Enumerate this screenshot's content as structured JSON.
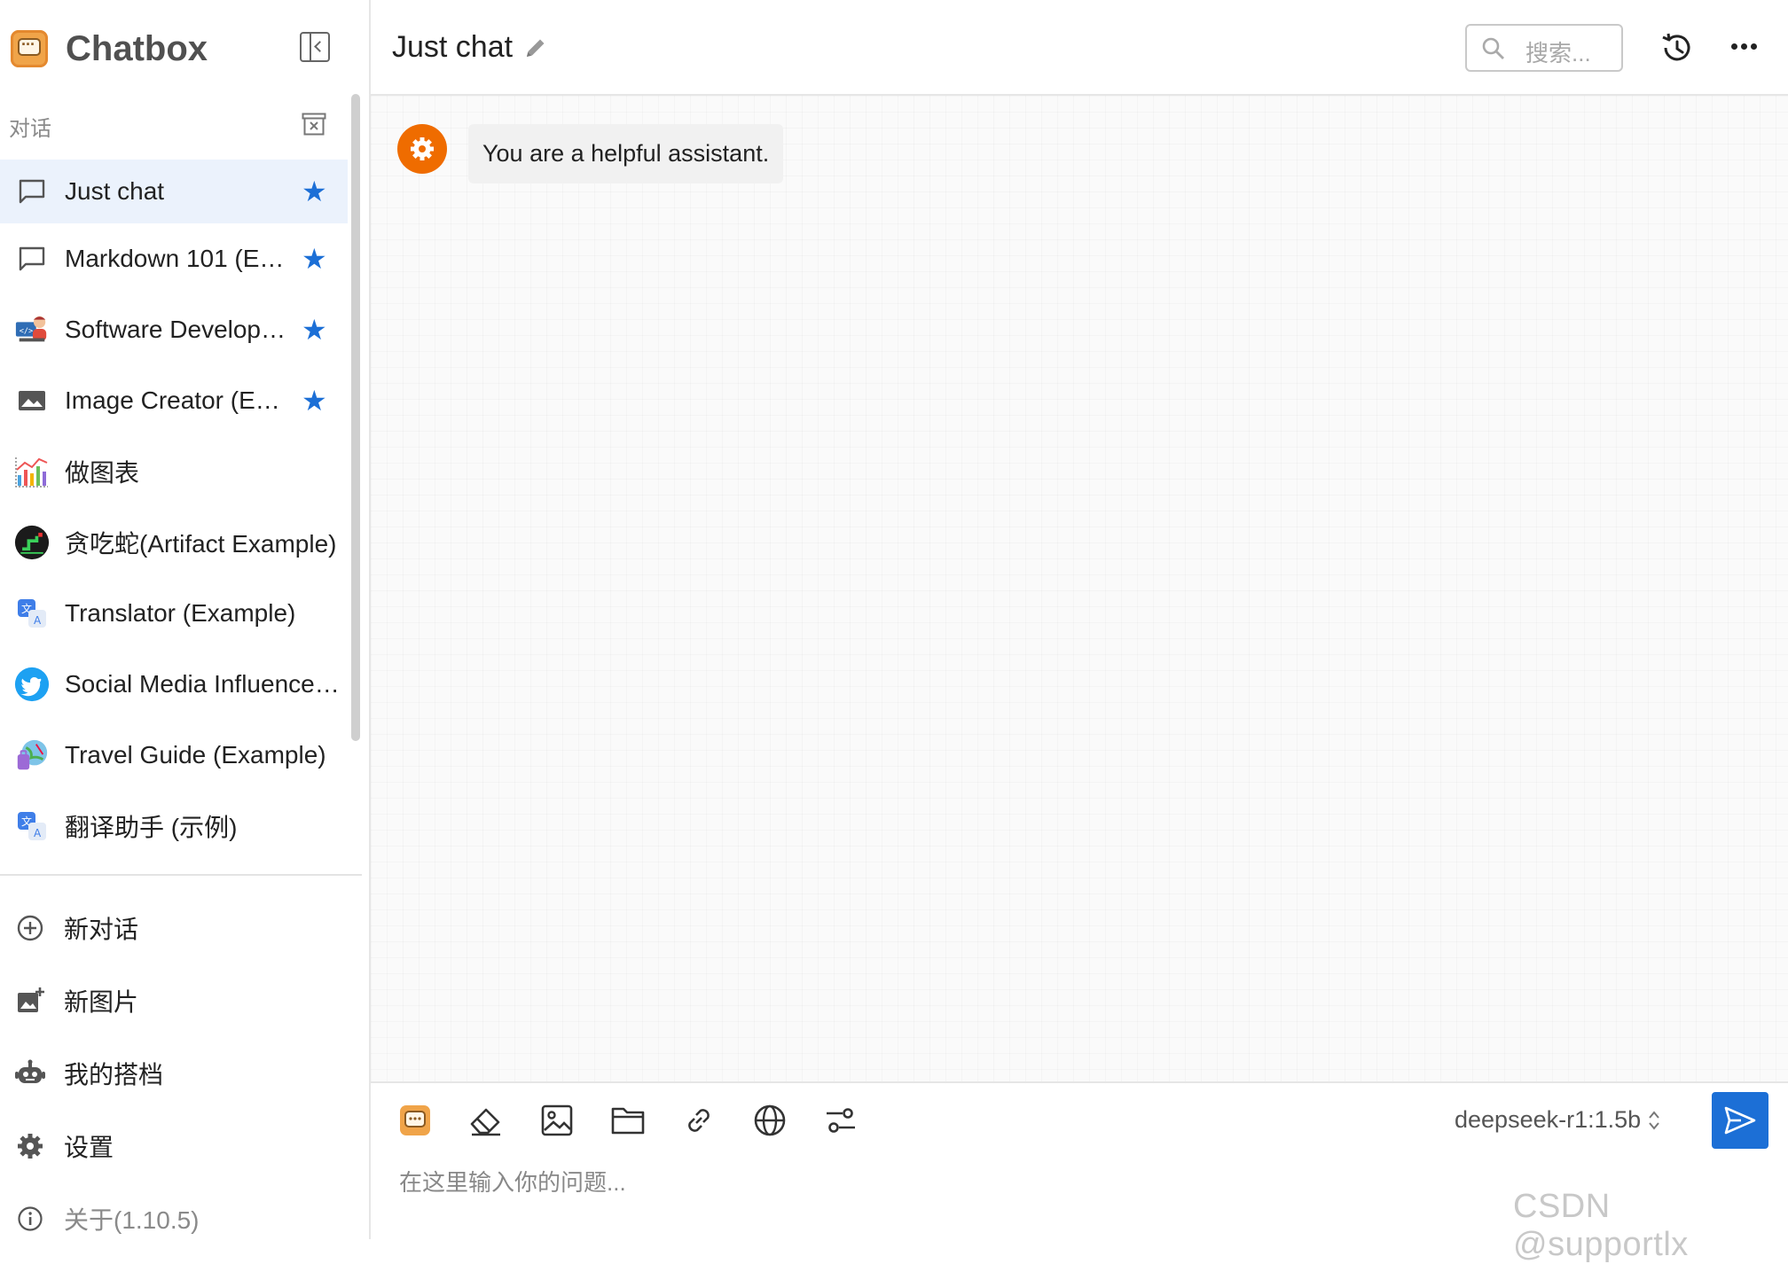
{
  "app": {
    "name": "Chatbox"
  },
  "sidebar": {
    "section_label": "对话",
    "conversations": [
      {
        "label": "Just chat",
        "icon": "chat-bubble-icon",
        "starred": true,
        "active": true
      },
      {
        "label": "Markdown 101 (E…",
        "icon": "chat-bubble-icon",
        "starred": true
      },
      {
        "label": "Software Develop…",
        "icon": "developer-avatar-icon",
        "starred": true
      },
      {
        "label": "Image Creator (E…",
        "icon": "image-icon",
        "starred": true
      },
      {
        "label": "做图表",
        "icon": "chart-avatar-icon",
        "starred": false
      },
      {
        "label": "贪吃蛇(Artifact Example)",
        "icon": "snake-game-avatar-icon",
        "starred": false
      },
      {
        "label": "Translator (Example)",
        "icon": "translate-avatar-icon",
        "starred": false
      },
      {
        "label": "Social Media Influence…",
        "icon": "twitter-avatar-icon",
        "starred": false
      },
      {
        "label": "Travel Guide (Example)",
        "icon": "travel-avatar-icon",
        "starred": false
      },
      {
        "label": "翻译助手 (示例)",
        "icon": "translate-avatar-icon",
        "starred": false
      }
    ],
    "menu": {
      "new_chat": "新对话",
      "new_image": "新图片",
      "my_copilots": "我的搭档",
      "settings": "设置",
      "about": "关于(1.10.5)"
    }
  },
  "header": {
    "title": "Just chat",
    "search_placeholder": "搜索..."
  },
  "messages": [
    {
      "role": "system",
      "icon": "gear-icon",
      "text": "You are a helpful assistant."
    }
  ],
  "composer": {
    "model": "deepseek-r1:1.5b",
    "input_placeholder": "在这里输入你的问题...",
    "tools": [
      "copilot-icon",
      "eraser-icon",
      "image-icon",
      "folder-icon",
      "link-icon",
      "globe-icon",
      "settings-sliders-icon"
    ]
  },
  "watermark": "CSDN @supportlx",
  "colors": {
    "accent": "#1c6fd6",
    "system_avatar": "#ef6c00",
    "active_bg": "#ebf2fc"
  }
}
